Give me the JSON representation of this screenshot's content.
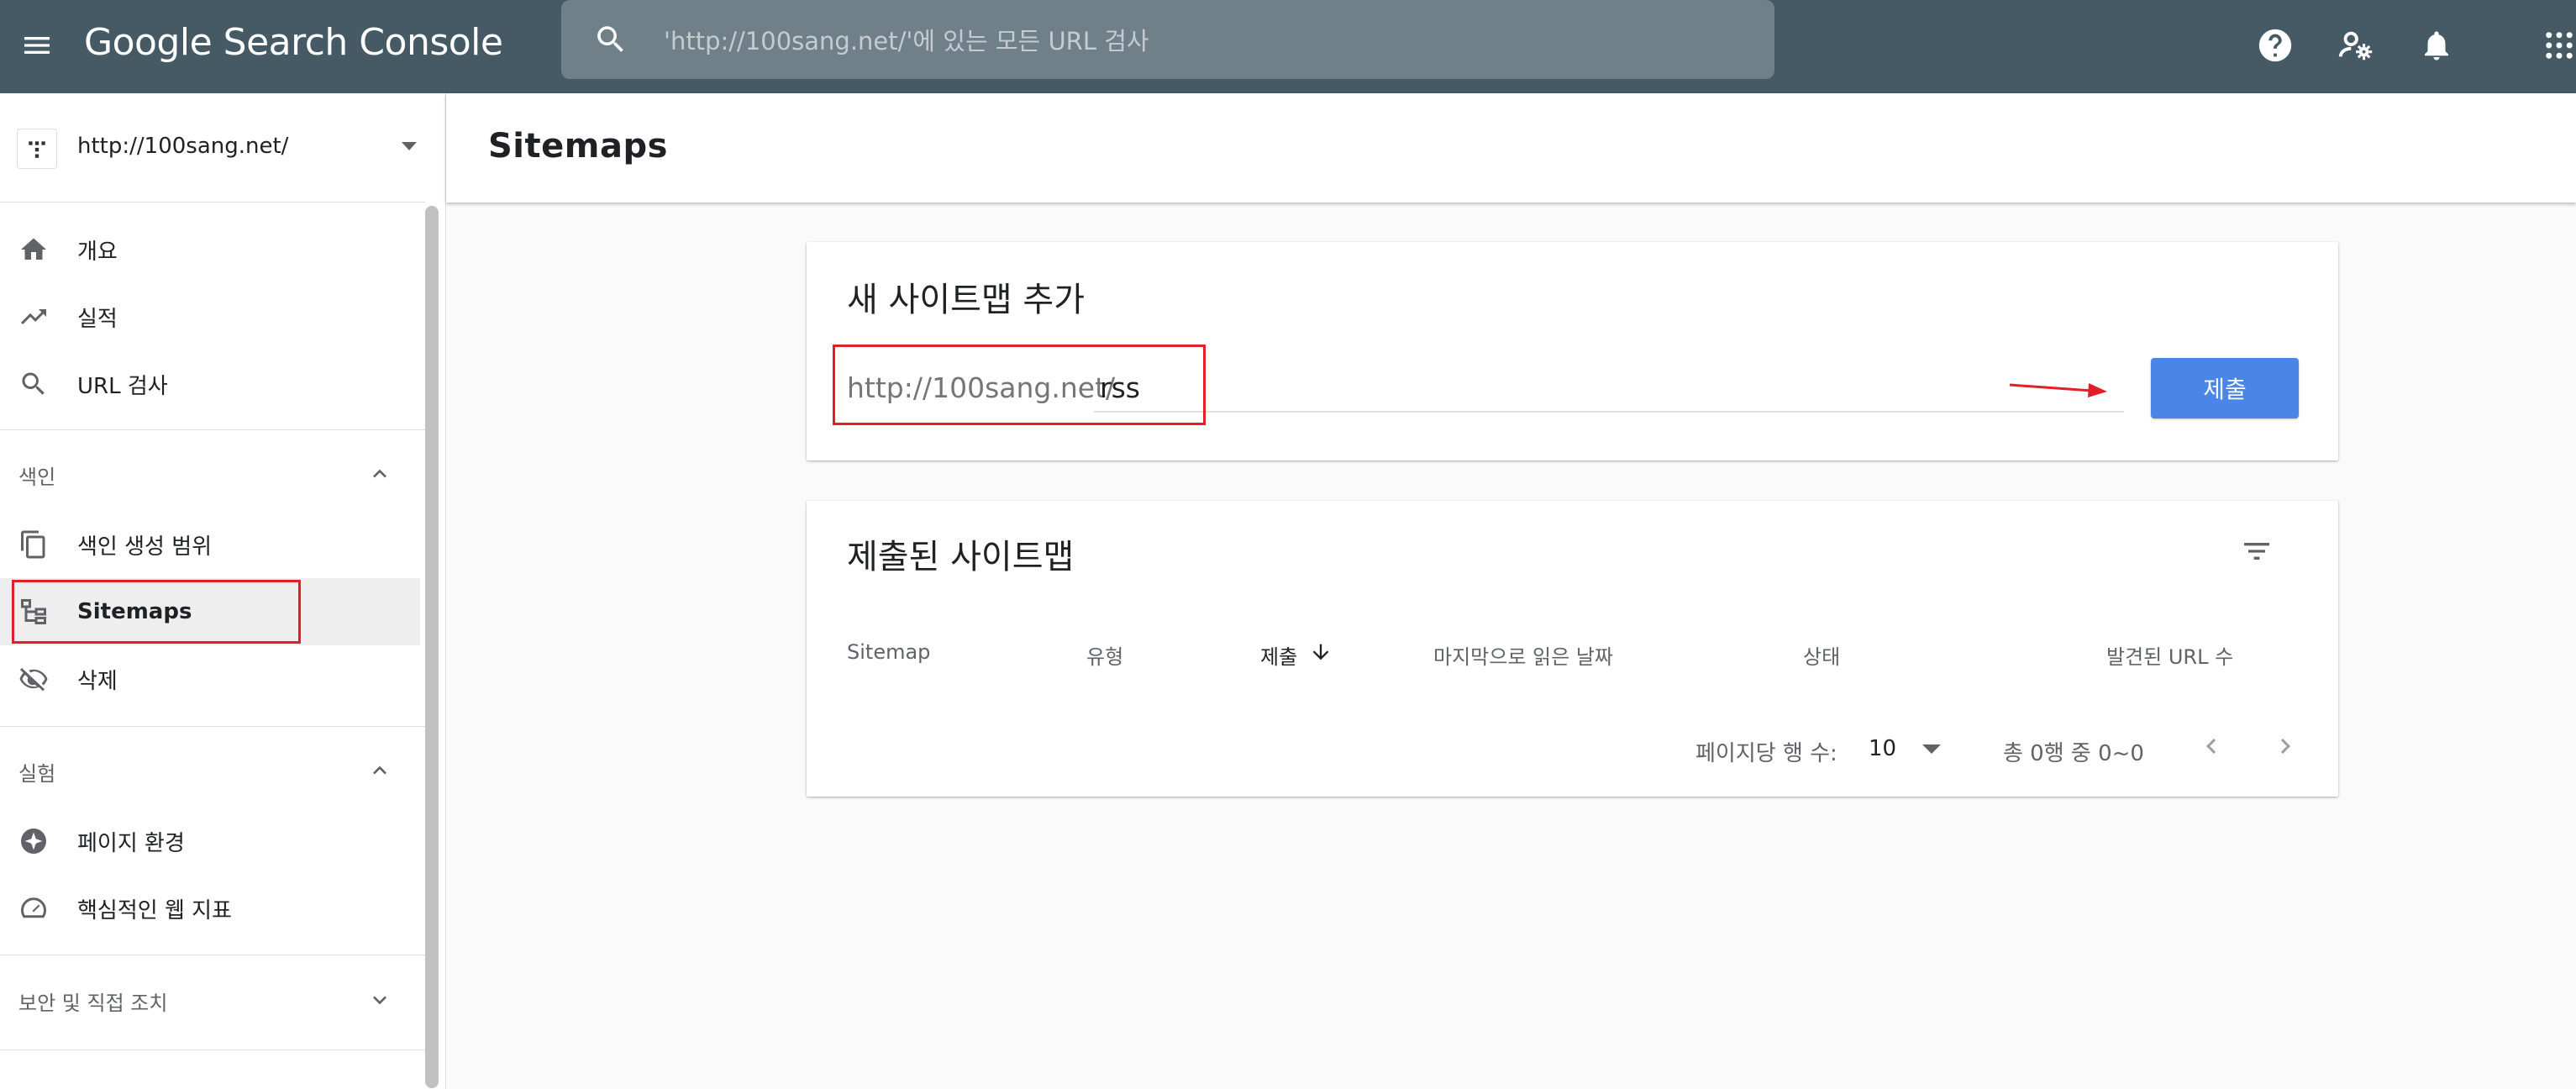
{
  "app": {
    "logo_text": "Google Search Console",
    "search_placeholder": "'http://100sang.net/'에 있는 모든 URL 검사"
  },
  "sidebar": {
    "property_url": "http://100sang.net/",
    "items_top": [
      {
        "label": "개요",
        "icon": "home-icon"
      },
      {
        "label": "실적",
        "icon": "trending-up-icon"
      },
      {
        "label": "URL 검사",
        "icon": "search-icon"
      }
    ],
    "section_index": {
      "title": "색인",
      "items": [
        {
          "label": "색인 생성 범위",
          "icon": "copy-icon"
        },
        {
          "label": "Sitemaps",
          "icon": "sitemap-icon",
          "active": true
        },
        {
          "label": "삭제",
          "icon": "eye-off-icon"
        }
      ]
    },
    "section_experience": {
      "title": "실험",
      "items": [
        {
          "label": "페이지 환경",
          "icon": "experience-icon"
        },
        {
          "label": "핵심적인 웹 지표",
          "icon": "speed-icon"
        }
      ]
    },
    "section_security": {
      "title": "보안 및 직접 조치"
    }
  },
  "main": {
    "page_title": "Sitemaps",
    "add_card": {
      "title": "새 사이트맵 추가",
      "prefix": "http://100sang.net/",
      "input_value": "rss",
      "submit_label": "제출"
    },
    "submitted_card": {
      "title": "제출된 사이트맵",
      "columns": [
        "Sitemap",
        "유형",
        "제출",
        "마지막으로 읽은 날짜",
        "상태",
        "발견된 URL 수"
      ],
      "rows_per_page_label": "페이지당 행 수:",
      "rows_per_page_value": "10",
      "range_text": "총 0행 중 0~0"
    }
  },
  "colors": {
    "appbar": "#455a64",
    "search_bg": "#6f8088",
    "accent": "#4a86e8",
    "annotation_red": "#e21f26"
  }
}
